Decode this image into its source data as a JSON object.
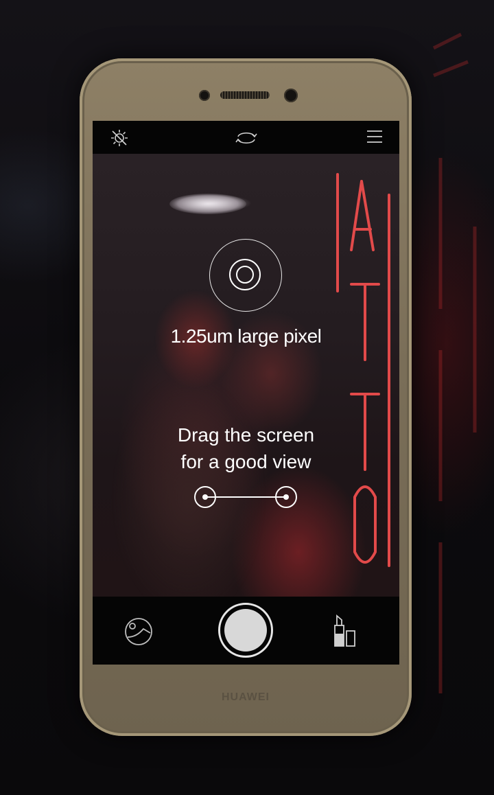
{
  "phone": {
    "brand": "HUAWEI"
  },
  "camera": {
    "top_icons": [
      "flash-off-icon",
      "switch-camera-icon",
      "menu-icon"
    ],
    "bottom_icons": [
      "gallery-icon",
      "shutter-button",
      "beauty-icon"
    ]
  },
  "overlay": {
    "pixel_caption": "1.25um large pixel",
    "drag_line1": "Drag the screen",
    "drag_line2": "for a good view"
  },
  "colors": {
    "overlay_text": "#ffffff",
    "phone_body": "#7a6e58",
    "neon": "#d83a3a"
  }
}
